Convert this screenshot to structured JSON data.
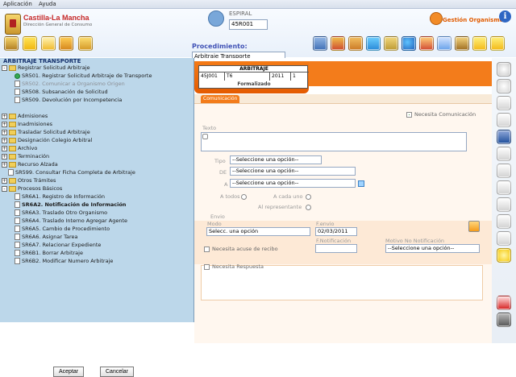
{
  "menu": {
    "items": [
      "Aplicación",
      "Ayuda"
    ]
  },
  "header": {
    "brand": "Castilla-La Mancha",
    "subtitle": "Dirección General de Consumo",
    "user_label": "ESPIRAL",
    "user_code": "45R001",
    "gestion_label": "Gestión Organismo",
    "procedimiento_label": "Procedimiento:",
    "procedimiento_value": "Arbitraje Transporte"
  },
  "tree": {
    "root": "ARBITRAJE TRANSPORTE",
    "nodes": [
      {
        "label": "Registrar Solicitud Arbitraje",
        "level": 1,
        "type": "folder",
        "expanded": true
      },
      {
        "label": "SR501. Registrar Solicitud Arbitraje de Transporte",
        "level": 2,
        "type": "doc",
        "selected": true
      },
      {
        "label": "SR502. Comunicar a Organismo Origen",
        "level": 2,
        "type": "doc",
        "muted": true
      },
      {
        "label": "SR508. Subsanación de Solicitud",
        "level": 2,
        "type": "doc"
      },
      {
        "label": "SR509. Devolución por Incompetencia",
        "level": 2,
        "type": "doc"
      },
      {
        "label": "Admisiones",
        "level": 1,
        "type": "folder"
      },
      {
        "label": "Inadmisiones",
        "level": 1,
        "type": "folder"
      },
      {
        "label": "Trasladar Solicitud Arbitraje",
        "level": 1,
        "type": "folder"
      },
      {
        "label": "Designación Colegio Arbitral",
        "level": 1,
        "type": "folder"
      },
      {
        "label": "Archivo",
        "level": 1,
        "type": "folder"
      },
      {
        "label": "Terminación",
        "level": 1,
        "type": "folder"
      },
      {
        "label": "Recurso Alzada",
        "level": 1,
        "type": "folder"
      },
      {
        "label": "SR599. Consultar Ficha Completa de Arbitraje",
        "level": 1,
        "type": "doc"
      },
      {
        "label": "Otros Trámites",
        "level": 1,
        "type": "folder"
      },
      {
        "label": "Procesos Básicos",
        "level": 1,
        "type": "folder",
        "expanded": true
      },
      {
        "label": "SR6A1. Registro de Información",
        "level": 2,
        "type": "doc"
      },
      {
        "label": "SR6A2. Notificación de Información",
        "level": 2,
        "type": "doc",
        "selected": true
      },
      {
        "label": "SR6A3. Traslado Otro Organismo",
        "level": 2,
        "type": "doc"
      },
      {
        "label": "SR6A4. Traslado Interno Agregar Agente",
        "level": 2,
        "type": "doc"
      },
      {
        "label": "SR6A5. Cambio de Procedimiento",
        "level": 2,
        "type": "doc"
      },
      {
        "label": "SR6A6. Asignar Tarea",
        "level": 2,
        "type": "doc"
      },
      {
        "label": "SR6A7. Relacionar Expediente",
        "level": 2,
        "type": "doc"
      },
      {
        "label": "SR6B1. Borrar Arbitraje",
        "level": 2,
        "type": "doc"
      },
      {
        "label": "SR6B2. Modificar Numero Arbitraje",
        "level": 2,
        "type": "doc"
      }
    ],
    "accept": "Aceptar",
    "cancel": "Cancelar"
  },
  "case": {
    "title": "ARBITRAJE",
    "cells": [
      "45J001",
      "T6",
      "2011",
      "1"
    ],
    "status": "Formalizado"
  },
  "tabs": [
    "Comunicación"
  ],
  "form": {
    "necesita_comunicacion": "Necesita Comunicación",
    "texto": "Texto",
    "tipo": "Tipo",
    "de": "DE",
    "a": "A",
    "placeholder": "--Seleccione una opción--",
    "a_todos": "A todos",
    "a_cada_uno": "A cada uno",
    "al_representante": "Al representante",
    "envio": "Envio",
    "modo": "Modo",
    "modo_value": "Selecc. una opción",
    "fenvio": "F.envio",
    "fenvio_value": "02/03/2011",
    "fnotificacion": "F.Notificación",
    "motivo": "Motivo No Notificación",
    "necesita_acuse": "Necesita acuse de recibo",
    "necesita_respuesta": "Necesita Respuesta"
  },
  "colors": {
    "accent": "#f37c1b",
    "panel": "#bcd7ea",
    "brand": "#c62828"
  }
}
